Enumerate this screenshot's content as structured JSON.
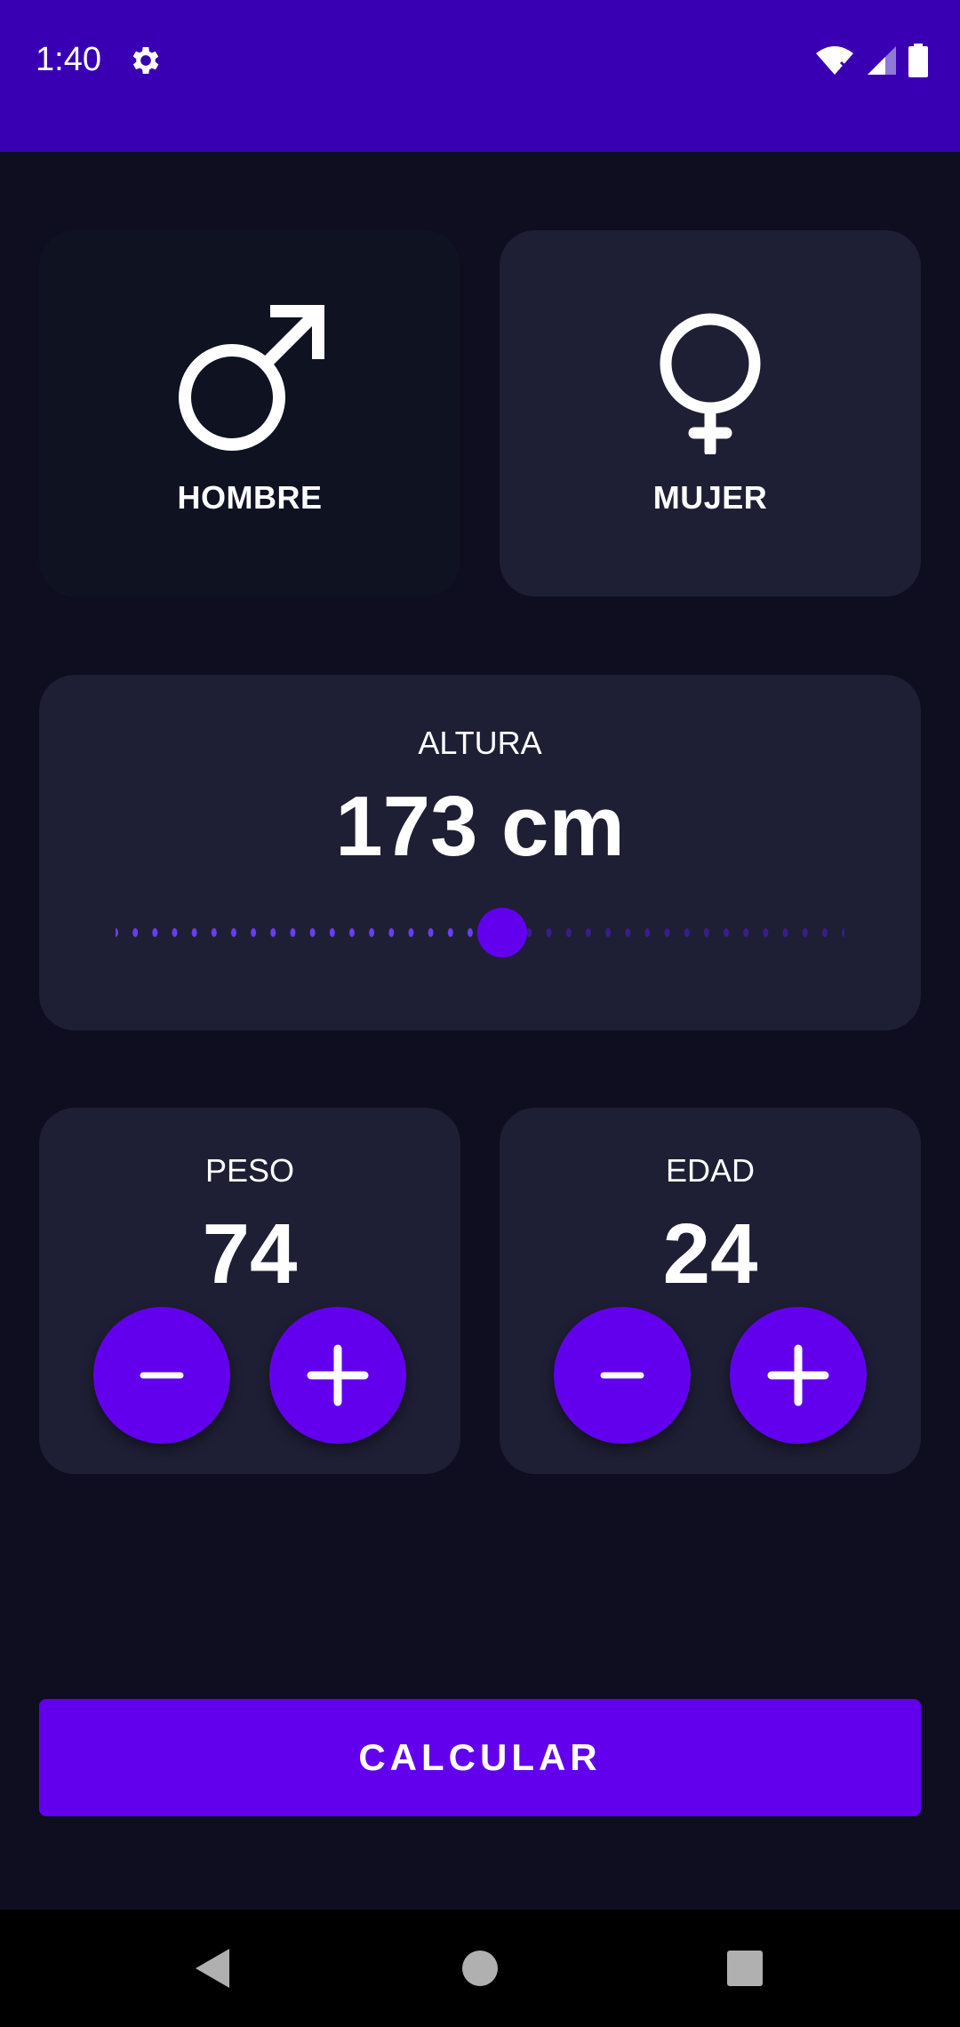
{
  "status_bar": {
    "time": "1:40",
    "icons": [
      "settings-icon",
      "wifi-icon",
      "signal-icon",
      "battery-icon"
    ],
    "background": "#3900b3"
  },
  "gender": {
    "male_label": "HOMBRE",
    "female_label": "MUJER",
    "selected": "male"
  },
  "height": {
    "title": "ALTURA",
    "value_label": "173 cm",
    "slider_fraction": 0.53
  },
  "weight": {
    "title": "PESO",
    "value": "74"
  },
  "age": {
    "title": "EDAD",
    "value": "24"
  },
  "calculate_label": "CALCULAR",
  "colors": {
    "accent": "#6200ee",
    "card": "#1e1f34",
    "card_selected": "#0e1221",
    "background": "#0f0d20"
  },
  "nav": {
    "icons": [
      "back-icon",
      "home-icon",
      "recents-icon"
    ]
  }
}
